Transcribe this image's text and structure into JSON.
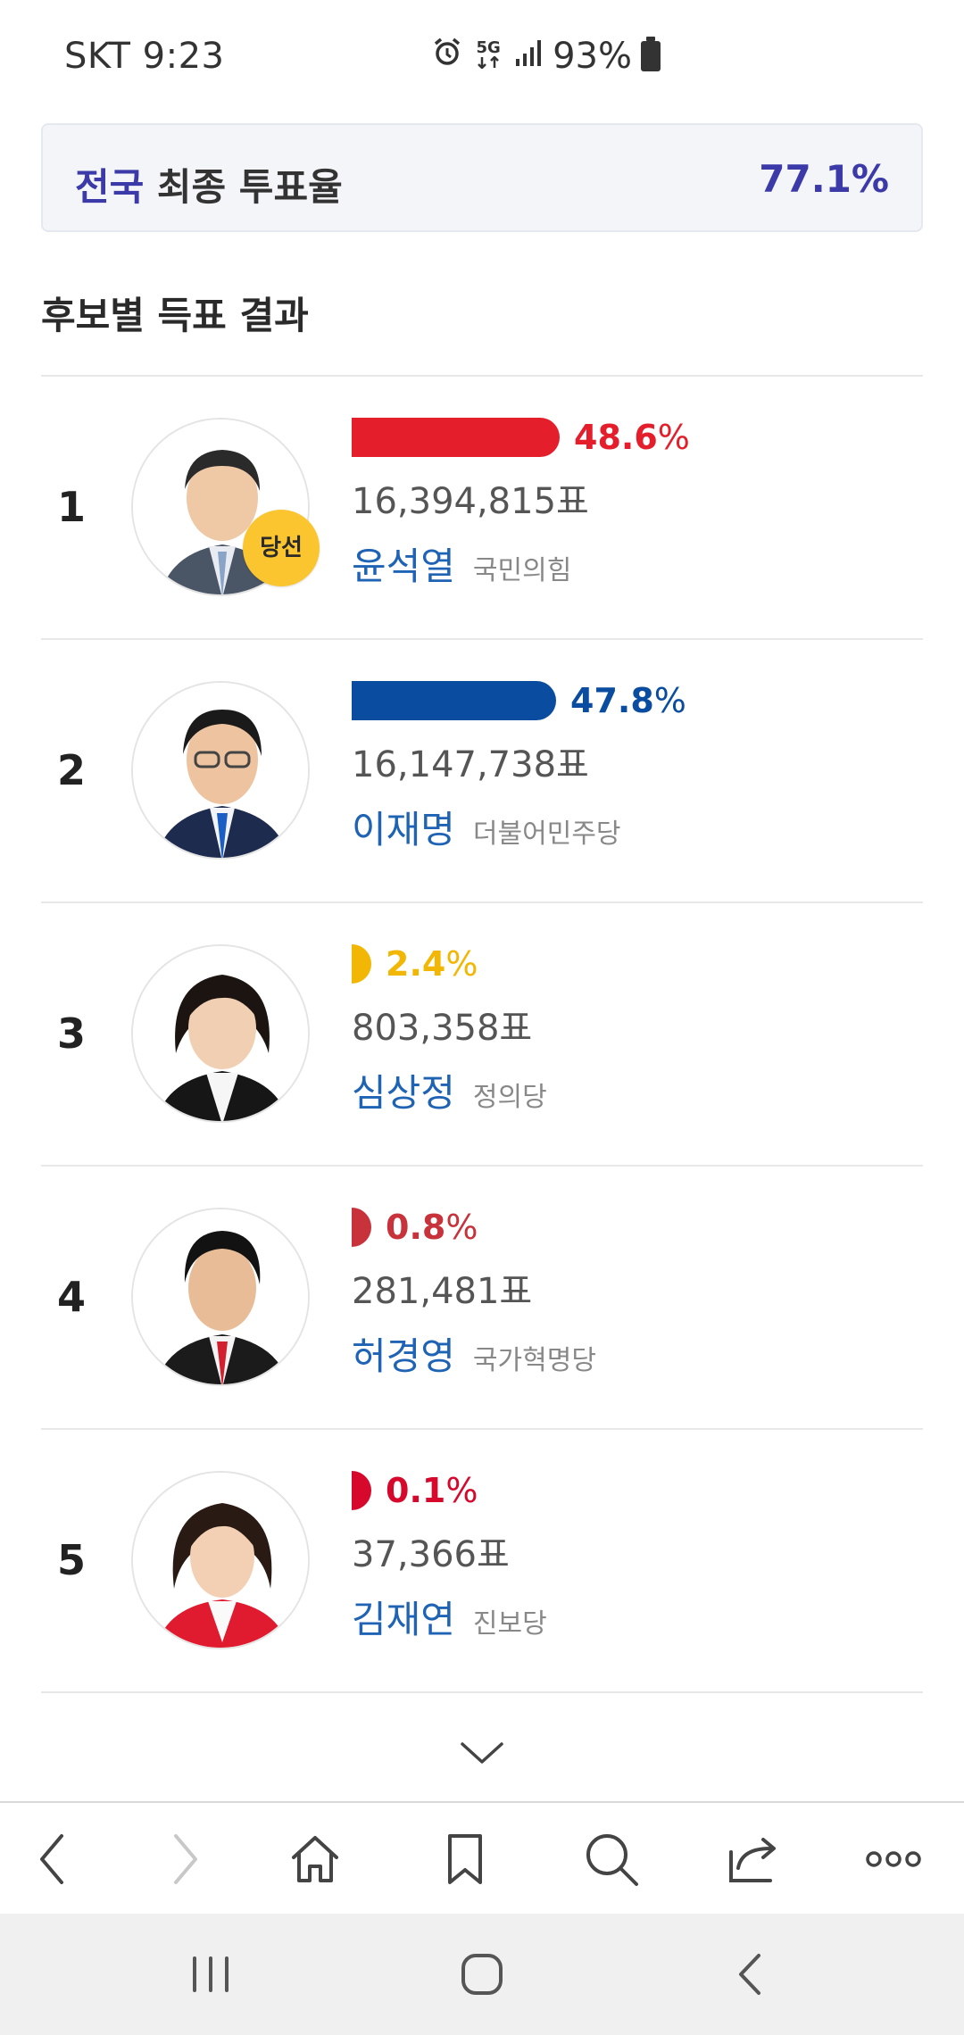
{
  "status_bar": {
    "carrier_time": "SKT 9:23",
    "network": "5G",
    "battery": "93%"
  },
  "turnout": {
    "region": "전국",
    "label": "최종 투표율",
    "value": "77.1%"
  },
  "section_title": "후보별 득표 결과",
  "candidates": [
    {
      "rank": "1",
      "pct_num": "48.6",
      "pct_sign": "%",
      "share": 48.6,
      "votes": "16,394,815표",
      "name": "윤석열",
      "party": "국민의힘",
      "color": "#e41e2b",
      "winner_badge": "당선"
    },
    {
      "rank": "2",
      "pct_num": "47.8",
      "pct_sign": "%",
      "share": 47.8,
      "votes": "16,147,738표",
      "name": "이재명",
      "party": "더불어민주당",
      "color": "#0a4c9f"
    },
    {
      "rank": "3",
      "pct_num": "2.4",
      "pct_sign": "%",
      "share": 2.4,
      "votes": "803,358표",
      "name": "심상정",
      "party": "정의당",
      "color": "#f2b705"
    },
    {
      "rank": "4",
      "pct_num": "0.8",
      "pct_sign": "%",
      "share": 0.8,
      "votes": "281,481표",
      "name": "허경영",
      "party": "국가혁명당",
      "color": "#c8323a"
    },
    {
      "rank": "5",
      "pct_num": "0.1",
      "pct_sign": "%",
      "share": 0.1,
      "votes": "37,366표",
      "name": "김재연",
      "party": "진보당",
      "color": "#d6082c"
    }
  ],
  "icons": {
    "expand": "chevron-down-icon",
    "toolbar": [
      "back-icon",
      "forward-icon",
      "home-icon",
      "bookmark-icon",
      "search-icon",
      "tabs-icon",
      "more-icon"
    ],
    "system": [
      "recent-apps-icon",
      "home-button-icon",
      "system-back-icon"
    ]
  }
}
